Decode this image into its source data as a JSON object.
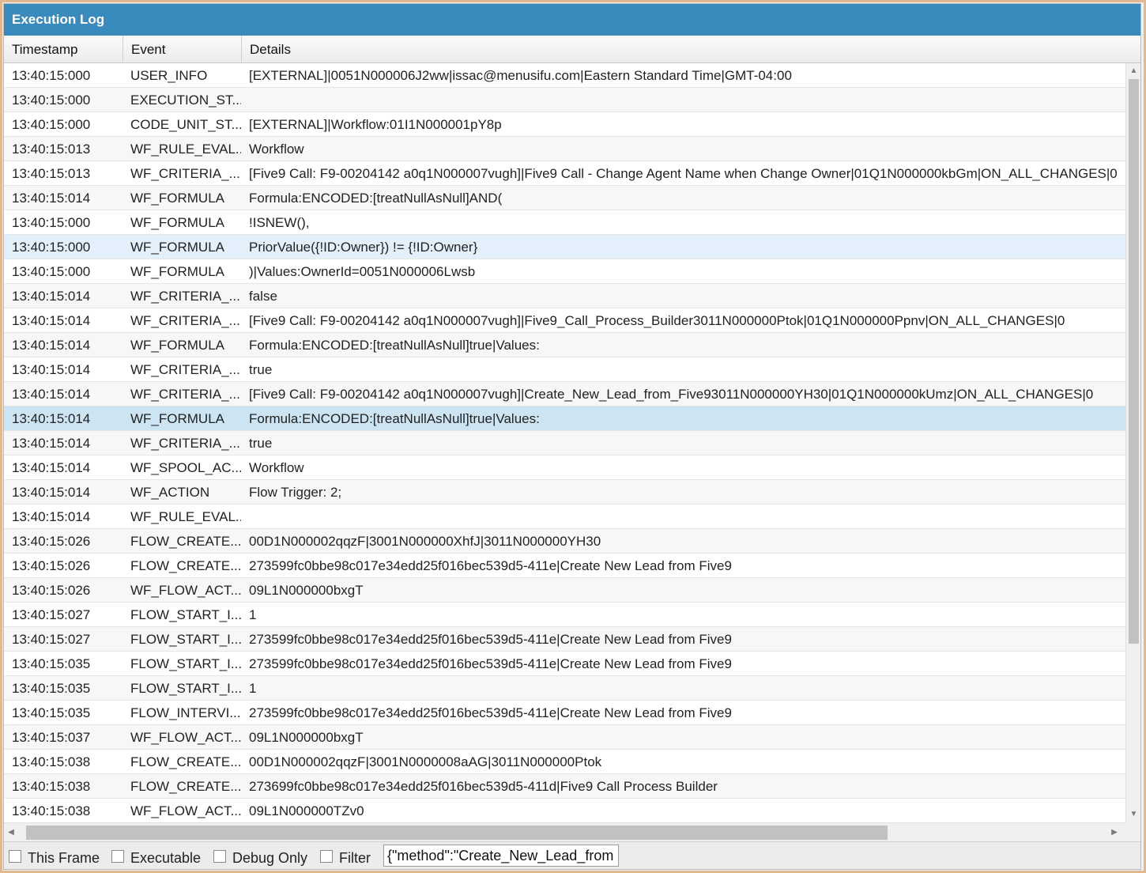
{
  "panel": {
    "title": "Execution Log"
  },
  "columns": {
    "timestamp": "Timestamp",
    "event": "Event",
    "details": "Details"
  },
  "rows": [
    {
      "ts": "13:40:15:000",
      "event": "USER_INFO",
      "details": "[EXTERNAL]|0051N000006J2ww|issac@menusifu.com|Eastern Standard Time|GMT-04:00"
    },
    {
      "ts": "13:40:15:000",
      "event": "EXECUTION_ST...",
      "details": ""
    },
    {
      "ts": "13:40:15:000",
      "event": "CODE_UNIT_ST...",
      "details": "[EXTERNAL]|Workflow:01I1N000001pY8p"
    },
    {
      "ts": "13:40:15:013",
      "event": "WF_RULE_EVAL...",
      "details": "Workflow"
    },
    {
      "ts": "13:40:15:013",
      "event": "WF_CRITERIA_...",
      "details": "[Five9 Call: F9-00204142 a0q1N000007vugh]|Five9 Call - Change Agent Name when Change Owner|01Q1N000000kbGm|ON_ALL_CHANGES|0"
    },
    {
      "ts": "13:40:15:014",
      "event": "WF_FORMULA",
      "details": "Formula:ENCODED:[treatNullAsNull]AND("
    },
    {
      "ts": "13:40:15:000",
      "event": "WF_FORMULA",
      "details": "!ISNEW(),"
    },
    {
      "ts": "13:40:15:000",
      "event": "WF_FORMULA",
      "details": "PriorValue({!ID:Owner}) != {!ID:Owner}"
    },
    {
      "ts": "13:40:15:000",
      "event": "WF_FORMULA",
      "details": ")|Values:OwnerId=0051N000006Lwsb"
    },
    {
      "ts": "13:40:15:014",
      "event": "WF_CRITERIA_...",
      "details": "false"
    },
    {
      "ts": "13:40:15:014",
      "event": "WF_CRITERIA_...",
      "details": "[Five9 Call: F9-00204142 a0q1N000007vugh]|Five9_Call_Process_Builder3011N000000Ptok|01Q1N000000Ppnv|ON_ALL_CHANGES|0"
    },
    {
      "ts": "13:40:15:014",
      "event": "WF_FORMULA",
      "details": "Formula:ENCODED:[treatNullAsNull]true|Values:"
    },
    {
      "ts": "13:40:15:014",
      "event": "WF_CRITERIA_...",
      "details": "true"
    },
    {
      "ts": "13:40:15:014",
      "event": "WF_CRITERIA_...",
      "details": "[Five9 Call: F9-00204142 a0q1N000007vugh]|Create_New_Lead_from_Five93011N000000YH30|01Q1N000000kUmz|ON_ALL_CHANGES|0"
    },
    {
      "ts": "13:40:15:014",
      "event": "WF_FORMULA",
      "details": "Formula:ENCODED:[treatNullAsNull]true|Values:"
    },
    {
      "ts": "13:40:15:014",
      "event": "WF_CRITERIA_...",
      "details": "true"
    },
    {
      "ts": "13:40:15:014",
      "event": "WF_SPOOL_AC...",
      "details": "Workflow"
    },
    {
      "ts": "13:40:15:014",
      "event": "WF_ACTION",
      "details": "Flow Trigger: 2;"
    },
    {
      "ts": "13:40:15:014",
      "event": "WF_RULE_EVAL...",
      "details": ""
    },
    {
      "ts": "13:40:15:026",
      "event": "FLOW_CREATE...",
      "details": "00D1N000002qqzF|3001N000000XhfJ|3011N000000YH30"
    },
    {
      "ts": "13:40:15:026",
      "event": "FLOW_CREATE...",
      "details": "273599fc0bbe98c017e34edd25f016bec539d5-411e|Create New Lead from Five9"
    },
    {
      "ts": "13:40:15:026",
      "event": "WF_FLOW_ACT...",
      "details": "09L1N000000bxgT"
    },
    {
      "ts": "13:40:15:027",
      "event": "FLOW_START_I...",
      "details": "1"
    },
    {
      "ts": "13:40:15:027",
      "event": "FLOW_START_I...",
      "details": "273599fc0bbe98c017e34edd25f016bec539d5-411e|Create New Lead from Five9"
    },
    {
      "ts": "13:40:15:035",
      "event": "FLOW_START_I...",
      "details": "273599fc0bbe98c017e34edd25f016bec539d5-411e|Create New Lead from Five9"
    },
    {
      "ts": "13:40:15:035",
      "event": "FLOW_START_I...",
      "details": "1"
    },
    {
      "ts": "13:40:15:035",
      "event": "FLOW_INTERVI...",
      "details": "273599fc0bbe98c017e34edd25f016bec539d5-411e|Create New Lead from Five9"
    },
    {
      "ts": "13:40:15:037",
      "event": "WF_FLOW_ACT...",
      "details": "09L1N000000bxgT"
    },
    {
      "ts": "13:40:15:038",
      "event": "FLOW_CREATE...",
      "details": "00D1N000002qqzF|3001N0000008aAG|3011N000000Ptok"
    },
    {
      "ts": "13:40:15:038",
      "event": "FLOW_CREATE...",
      "details": "273699fc0bbe98c017e34edd25f016bec539d5-411d|Five9 Call Process Builder"
    },
    {
      "ts": "13:40:15:038",
      "event": "WF_FLOW_ACT...",
      "details": "09L1N000000TZv0"
    }
  ],
  "highlighted_rows": [
    7,
    14
  ],
  "footer": {
    "this_frame": "This Frame",
    "executable": "Executable",
    "debug_only": "Debug Only",
    "filter": "Filter",
    "filter_value": "{\"method\":\"Create_New_Lead_from"
  },
  "icons": {
    "scroll_up": "triangle-up",
    "scroll_down": "triangle-down",
    "scroll_left": "triangle-left",
    "scroll_right": "triangle-right"
  },
  "colors": {
    "title_bar": "#3a8bbd",
    "selected_row": "#cde4f2",
    "hover_row": "#e3f0fb",
    "frame_border": "#e2b88e"
  }
}
